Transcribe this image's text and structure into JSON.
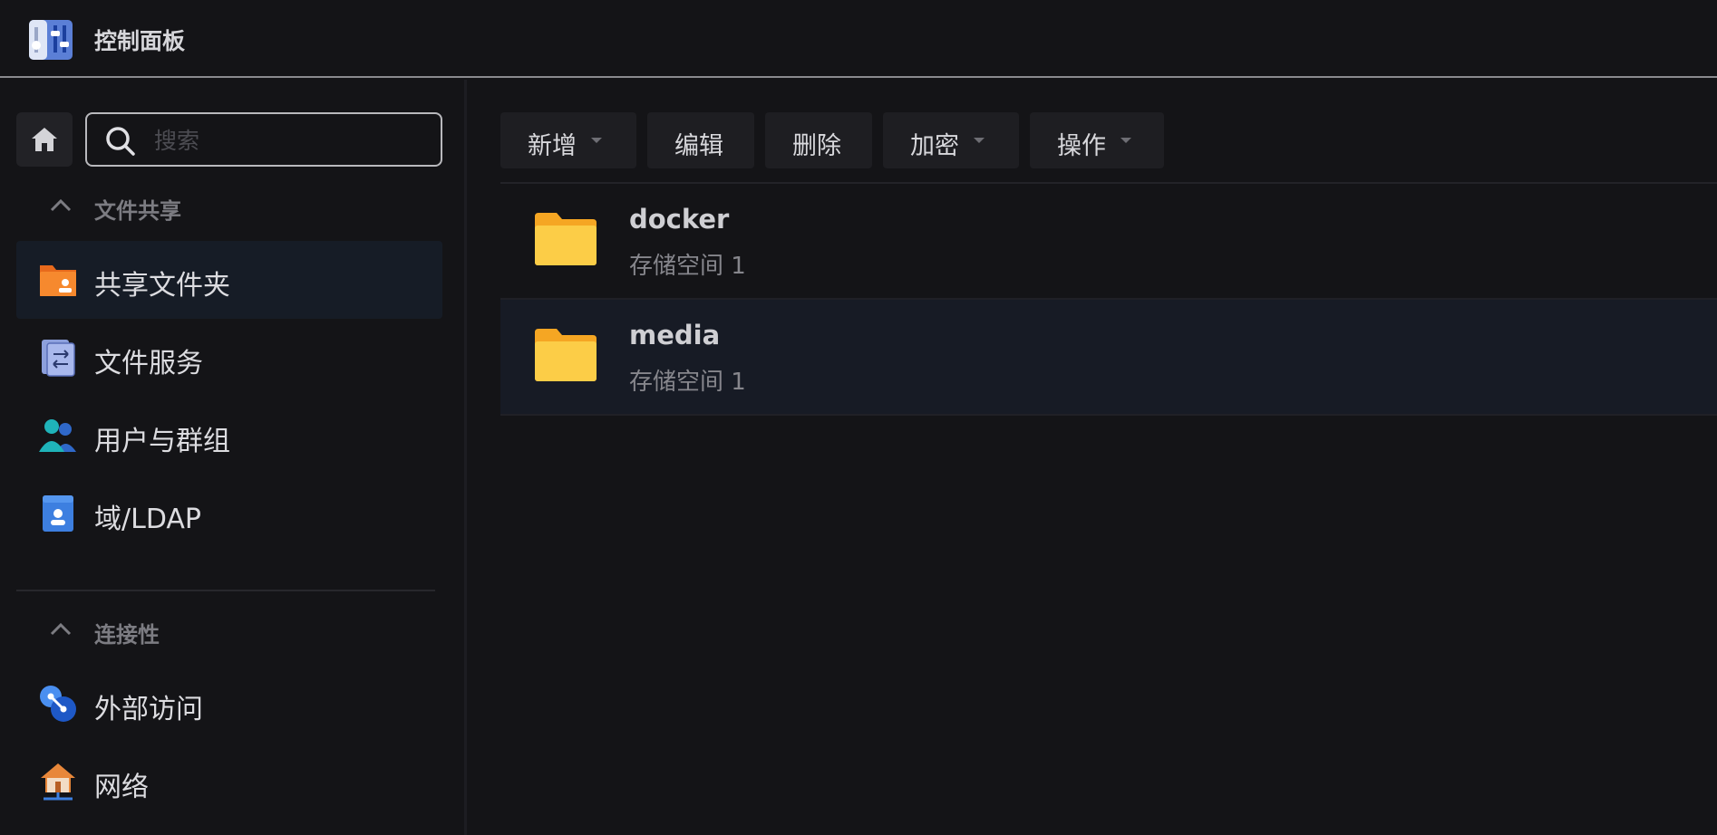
{
  "app": {
    "title": "控制面板",
    "icon": "control-panel-icon"
  },
  "search": {
    "placeholder": "搜索",
    "value": ""
  },
  "sidebar": {
    "groups": [
      {
        "label": "文件共享",
        "expanded": true,
        "items": [
          {
            "label": "共享文件夹",
            "icon": "shared-folder-icon",
            "active": true
          },
          {
            "label": "文件服务",
            "icon": "file-services-icon",
            "active": false
          },
          {
            "label": "用户与群组",
            "icon": "users-groups-icon",
            "active": false
          },
          {
            "label": "域/LDAP",
            "icon": "domain-ldap-icon",
            "active": false
          }
        ]
      },
      {
        "label": "连接性",
        "expanded": true,
        "items": [
          {
            "label": "外部访问",
            "icon": "external-access-icon",
            "active": false
          },
          {
            "label": "网络",
            "icon": "network-icon",
            "active": false
          }
        ]
      }
    ]
  },
  "toolbar": {
    "create": "新增",
    "edit": "编辑",
    "delete": "删除",
    "encrypt": "加密",
    "action": "操作"
  },
  "folders": [
    {
      "name": "docker",
      "location": "存储空间 1",
      "selected": false
    },
    {
      "name": "media",
      "location": "存储空间 1",
      "selected": true
    }
  ],
  "colors": {
    "background": "#141417",
    "active_item": "#161c26",
    "folder": "#f9c23c",
    "accent_blue": "#3d7fe0"
  }
}
